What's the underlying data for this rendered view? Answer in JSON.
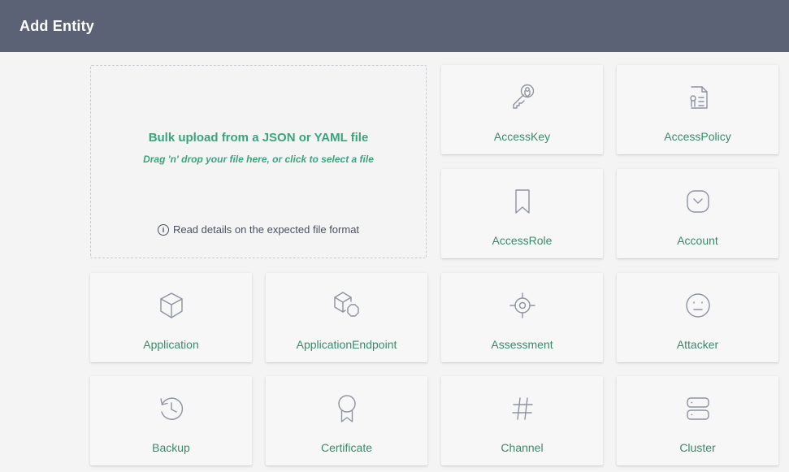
{
  "header": {
    "title": "Add Entity"
  },
  "upload": {
    "heading": "Bulk upload from a JSON or YAML file",
    "subtext": "Drag 'n' drop your file here, or click to select a file",
    "details_icon": "i",
    "details": "Read details on the expected file format"
  },
  "entities": [
    {
      "label": "AccessKey",
      "icon": "key-icon"
    },
    {
      "label": "AccessPolicy",
      "icon": "policy-document-icon"
    },
    {
      "label": "AccessRole",
      "icon": "bookmark-icon"
    },
    {
      "label": "Account",
      "icon": "account-icon"
    },
    {
      "label": "Application",
      "icon": "cube-icon"
    },
    {
      "label": "ApplicationEndpoint",
      "icon": "cube-endpoint-icon"
    },
    {
      "label": "Assessment",
      "icon": "crosshair-icon"
    },
    {
      "label": "Attacker",
      "icon": "neutral-face-icon"
    },
    {
      "label": "Backup",
      "icon": "history-icon"
    },
    {
      "label": "Certificate",
      "icon": "ribbon-icon"
    },
    {
      "label": "Channel",
      "icon": "hashtag-icon"
    },
    {
      "label": "Cluster",
      "icon": "server-icon"
    }
  ],
  "colors": {
    "header_bg": "#5b6275",
    "accent": "#3aa57c",
    "label": "#3a8a68",
    "icon": "#8e93a0"
  }
}
